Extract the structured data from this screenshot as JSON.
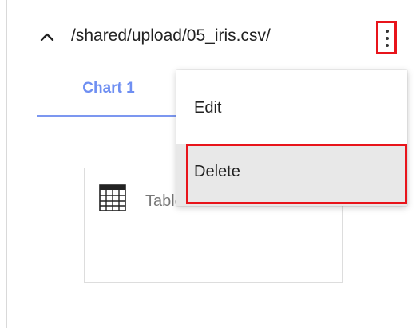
{
  "header": {
    "path": "/shared/upload/05_iris.csv/",
    "collapse_icon": "chevron-up-icon",
    "menu_icon": "kebab-vertical-icon"
  },
  "tabs": [
    {
      "label": "Chart 1",
      "active": true
    }
  ],
  "card": {
    "icon": "table-grid-icon",
    "label": "Table"
  },
  "context_menu": {
    "items": [
      {
        "label": "Edit"
      },
      {
        "label": "Delete",
        "hovered": true
      }
    ]
  },
  "colors": {
    "accent": "#6f8ff2",
    "highlight_annotation": "#e8141b",
    "hover_background": "#e8e8e8"
  }
}
